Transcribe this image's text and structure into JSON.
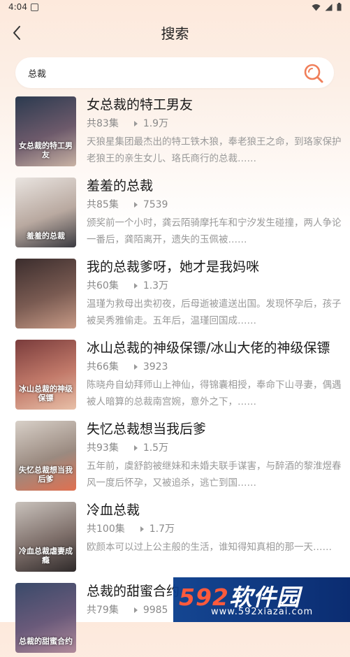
{
  "status_bar": {
    "time": "4:04"
  },
  "header": {
    "title": "搜索"
  },
  "search": {
    "value": "总裁"
  },
  "results": [
    {
      "title": "女总裁的特工男友",
      "episodes": "共83集",
      "views": "1.9万",
      "description": "天狼星集团最杰出的特工铁木狼，奉老狼王之命，到珞家保护老狼王的亲生女儿、珞氏商行的总裁……",
      "cover_text": "女总裁的特工男友",
      "cover_colors": [
        "#2b3a4f",
        "#6d5a6b",
        "#c9b3a4"
      ]
    },
    {
      "title": "羞羞的总裁",
      "episodes": "共85集",
      "views": "7539",
      "description": "颁奖前一个小时，龚云陌骑摩托车和宁汐发生碰撞，两人争论一番后，龚陌离开，遗失的玉佩被……",
      "cover_text": "羞羞的总裁",
      "cover_colors": [
        "#e9e4e0",
        "#b9a9a0",
        "#3a3a40"
      ]
    },
    {
      "title": "我的总裁爹呀，她才是我妈咪",
      "episodes": "共60集",
      "views": "1.3万",
      "description": "温瑾为救母出卖初夜，后母逝被遣送出国。发现怀孕后，孩子被吴秀雅偷走。五年后，温瑾回国成……",
      "cover_text": "",
      "cover_colors": [
        "#3b2d2d",
        "#7a5b52",
        "#c79a86"
      ]
    },
    {
      "title": "冰山总裁的神级保镖/冰山大佬的神级保镖",
      "episodes": "共66集",
      "views": "3923",
      "description": "陈晓舟自幼拜师山上神仙，得锦囊相授，奉命下山寻妻，偶遇被人暗算的总裁南宫婉，意外之下，……",
      "cover_text": "冰山总裁的神级保镖",
      "cover_colors": [
        "#7a3c3c",
        "#c27a6a",
        "#e8c0a8"
      ]
    },
    {
      "title": "失忆总裁想当我后爹",
      "episodes": "共93集",
      "views": "1.5万",
      "description": "五年前，虞舒韵被继妹和未婚夫联手谋害，与醉酒的黎淮煜春风一度后怀孕，又被追杀，逃亡到国……",
      "cover_text": "失忆总裁想当我后爹",
      "cover_colors": [
        "#d8d0c8",
        "#9a8a80",
        "#e07050"
      ]
    },
    {
      "title": "冷血总裁",
      "episodes": "共100集",
      "views": "1.7万",
      "description": "欧颜本可以过上公主般的生活，谁知得知真相的那一天……",
      "cover_text": "冷血总裁虐妻成瘾",
      "cover_colors": [
        "#c9c2bc",
        "#7e6f6a",
        "#2f2a2a"
      ]
    },
    {
      "title": "总裁的甜蜜合约",
      "episodes": "共79集",
      "views": "9985",
      "description": "",
      "cover_text": "总裁的甜蜜合约",
      "cover_colors": [
        "#3a4a6a",
        "#6a5a7a",
        "#b08a9a"
      ]
    }
  ],
  "watermark": {
    "line1_num": "592",
    "line1_text": "软件园",
    "line2": "www.592xiazai.com"
  },
  "colors": {
    "accent": "#f07f5a",
    "title": "#1a1a1a",
    "meta": "#8a8a8a"
  }
}
